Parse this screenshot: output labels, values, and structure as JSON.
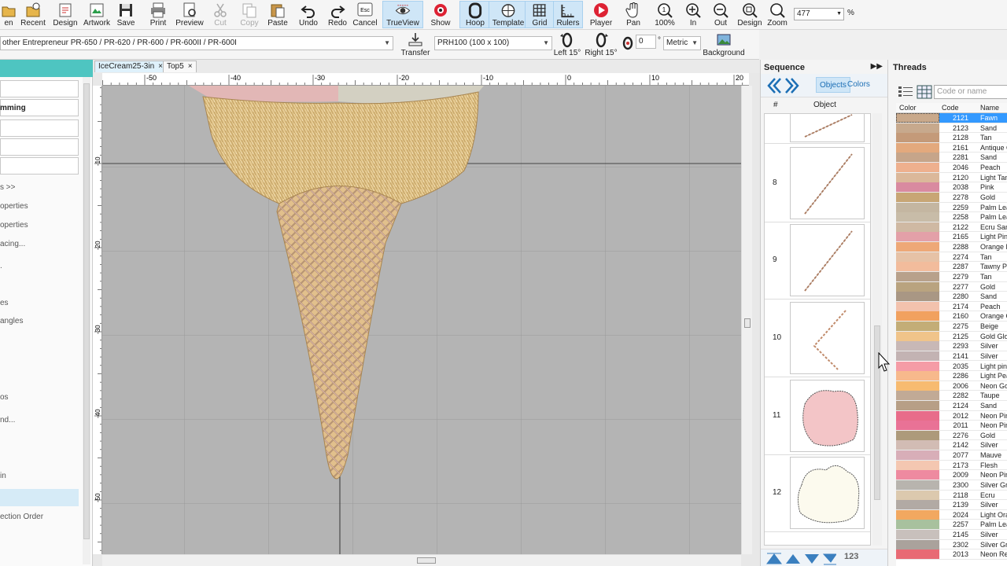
{
  "toolbar": {
    "buttons": [
      {
        "label": "en",
        "icon": "open-icon"
      },
      {
        "label": "Recent",
        "icon": "recent-icon"
      },
      {
        "label": "Design",
        "icon": "design-icon"
      },
      {
        "label": "Artwork",
        "icon": "artwork-icon"
      },
      {
        "label": "Save",
        "icon": "save-icon"
      },
      {
        "label": "Print",
        "icon": "print-icon"
      },
      {
        "label": "Preview",
        "icon": "preview-icon"
      },
      {
        "label": "Cut",
        "icon": "cut-icon"
      },
      {
        "label": "Copy",
        "icon": "copy-icon"
      },
      {
        "label": "Paste",
        "icon": "paste-icon"
      },
      {
        "label": "Undo",
        "icon": "undo-icon"
      },
      {
        "label": "Redo",
        "icon": "redo-icon"
      },
      {
        "label": "Cancel",
        "icon": "cancel-icon",
        "key": "Esc"
      },
      {
        "label": "TrueView",
        "icon": "trueview-icon"
      },
      {
        "label": "Show",
        "icon": "show-icon"
      },
      {
        "label": "Hoop",
        "icon": "hoop-icon"
      },
      {
        "label": "Template",
        "icon": "template-icon"
      },
      {
        "label": "Grid",
        "icon": "grid-icon"
      },
      {
        "label": "Rulers",
        "icon": "rulers-icon"
      },
      {
        "label": "Player",
        "icon": "player-icon"
      },
      {
        "label": "Pan",
        "icon": "pan-icon"
      },
      {
        "label": "100%",
        "icon": "zoom-100-icon"
      },
      {
        "label": "In",
        "icon": "zoom-in-icon"
      },
      {
        "label": "Out",
        "icon": "zoom-out-icon"
      },
      {
        "label": "Design",
        "icon": "zoom-design-icon"
      },
      {
        "label": "Zoom",
        "icon": "zoom-icon"
      }
    ],
    "zoom_value": "477",
    "zoom_unit": "%"
  },
  "toolbar2": {
    "machine": "other Entrepreneur PR-650 / PR-620 / PR-600 / PR-600II / PR-600I",
    "transfer_label": "Transfer",
    "hoop": "PRH100 (100 x 100)",
    "left_label": "Left 15°",
    "right_label": "Right 15°",
    "angle_value": "0",
    "angle_unit": "°",
    "units": "Metric",
    "background_label": "Background"
  },
  "left_panel": {
    "items": [
      {
        "text": "mming",
        "bold": true
      },
      {
        "text": "s >>",
        "bold": false
      },
      {
        "text": "operties",
        "bold": false
      },
      {
        "text": "operties",
        "bold": false
      },
      {
        "text": "acing...",
        "bold": false
      },
      {
        "text": ".",
        "bold": false
      },
      {
        "text": "es",
        "bold": false
      },
      {
        "text": "angles",
        "bold": false
      },
      {
        "text": "os",
        "bold": false
      },
      {
        "text": "nd...",
        "bold": false
      },
      {
        "text": "in",
        "bold": false
      },
      {
        "text": "ection Order",
        "bold": false
      }
    ]
  },
  "tabs": [
    {
      "label": "IceCream25-3in",
      "close": "×"
    },
    {
      "label": "Top5",
      "close": "×"
    }
  ],
  "ruler_h": [
    "-50",
    "-40",
    "-30",
    "-20",
    "-10",
    "0",
    "10",
    "20"
  ],
  "ruler_v": [
    "-10",
    "-20",
    "-30",
    "-40",
    "-50"
  ],
  "sequence": {
    "title": "Sequence",
    "tab_objects": "Objects",
    "tab_colors": "Colors",
    "col_num": "#",
    "col_object": "Object",
    "rows": [
      {
        "num": "",
        "kind": "line"
      },
      {
        "num": "8",
        "kind": "line"
      },
      {
        "num": "9",
        "kind": "line"
      },
      {
        "num": "10",
        "kind": "angle"
      },
      {
        "num": "11",
        "kind": "pink"
      },
      {
        "num": "12",
        "kind": "cream"
      }
    ],
    "badge": "123"
  },
  "threads": {
    "title": "Threads",
    "search_placeholder": "Code or name",
    "col_color": "Color",
    "col_code": "Code",
    "col_name": "Name",
    "rows": [
      {
        "code": "2121",
        "name": "Fawn",
        "color": "#c9a98b",
        "selected": true
      },
      {
        "code": "2123",
        "name": "Sand",
        "color": "#c7a98d"
      },
      {
        "code": "2128",
        "name": "Tan",
        "color": "#c49a79"
      },
      {
        "code": "2161",
        "name": "Antique G",
        "color": "#e3a97d"
      },
      {
        "code": "2281",
        "name": "Sand",
        "color": "#c6a58a"
      },
      {
        "code": "2046",
        "name": "Peach",
        "color": "#eeb08e"
      },
      {
        "code": "2120",
        "name": "Light Tan",
        "color": "#dbb89a"
      },
      {
        "code": "2038",
        "name": "Pink",
        "color": "#d98aa0"
      },
      {
        "code": "2278",
        "name": "Gold",
        "color": "#c8a675"
      },
      {
        "code": "2259",
        "name": "Palm Leaf",
        "color": "#c4b6a1"
      },
      {
        "code": "2258",
        "name": "Palm Leaf",
        "color": "#c8bca8"
      },
      {
        "code": "2122",
        "name": "Ecru Sand",
        "color": "#cfb9a3"
      },
      {
        "code": "2165",
        "name": "Light Pink",
        "color": "#e3a0a8"
      },
      {
        "code": "2288",
        "name": "Orange B",
        "color": "#eea877"
      },
      {
        "code": "2274",
        "name": "Tan",
        "color": "#e6c2a6"
      },
      {
        "code": "2287",
        "name": "Tawny Pe",
        "color": "#f2bc9c"
      },
      {
        "code": "2279",
        "name": "Tan",
        "color": "#b8a18b"
      },
      {
        "code": "2277",
        "name": "Gold",
        "color": "#b9a37f"
      },
      {
        "code": "2280",
        "name": "Sand",
        "color": "#a99784"
      },
      {
        "code": "2174",
        "name": "Peach",
        "color": "#f2c2ad"
      },
      {
        "code": "2160",
        "name": "Orange G",
        "color": "#f1a15f"
      },
      {
        "code": "2275",
        "name": "Beige",
        "color": "#c3ad77"
      },
      {
        "code": "2125",
        "name": "Gold Glow",
        "color": "#f0c48a"
      },
      {
        "code": "2293",
        "name": "Silver",
        "color": "#c8b8b6"
      },
      {
        "code": "2141",
        "name": "Silver",
        "color": "#c3b3b3"
      },
      {
        "code": "2035",
        "name": "Light pink",
        "color": "#f59ca6"
      },
      {
        "code": "2286",
        "name": "Light Pea",
        "color": "#f7b98c"
      },
      {
        "code": "2006",
        "name": "Neon Gol",
        "color": "#f7bb70"
      },
      {
        "code": "2282",
        "name": "Taupe",
        "color": "#c1aa96"
      },
      {
        "code": "2124",
        "name": "Sand",
        "color": "#b79f86"
      },
      {
        "code": "2012",
        "name": "Neon Pin",
        "color": "#e86c8a"
      },
      {
        "code": "2011",
        "name": "Neon Pin",
        "color": "#e97296"
      },
      {
        "code": "2276",
        "name": "Gold",
        "color": "#ad9a7b"
      },
      {
        "code": "2142",
        "name": "Silver",
        "color": "#d2bcb4"
      },
      {
        "code": "2077",
        "name": "Mauve",
        "color": "#d8aeb8"
      },
      {
        "code": "2173",
        "name": "Flesh",
        "color": "#f4c7b1"
      },
      {
        "code": "2009",
        "name": "Neon Pin",
        "color": "#ee8aa0"
      },
      {
        "code": "2300",
        "name": "Silver Gre",
        "color": "#b8b4ae"
      },
      {
        "code": "2118",
        "name": "Ecru",
        "color": "#dcc9ae"
      },
      {
        "code": "2139",
        "name": "Silver",
        "color": "#b2aaa4"
      },
      {
        "code": "2024",
        "name": "Light Ora",
        "color": "#f2a860"
      },
      {
        "code": "2257",
        "name": "Palm Leaf",
        "color": "#a8c19e"
      },
      {
        "code": "2145",
        "name": "Silver",
        "color": "#c8c0bc"
      },
      {
        "code": "2302",
        "name": "Silver Gre",
        "color": "#aaa29c"
      },
      {
        "code": "2013",
        "name": "Neon Red",
        "color": "#e86a74"
      }
    ]
  }
}
